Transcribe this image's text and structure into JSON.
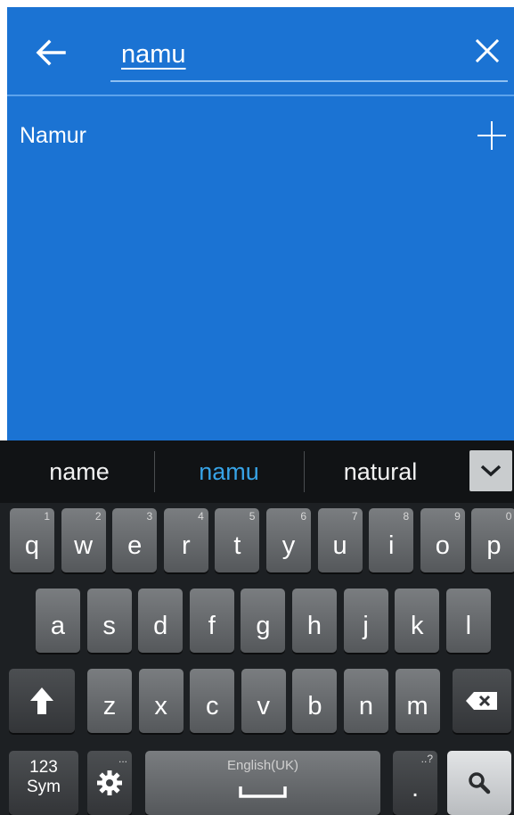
{
  "search": {
    "value": "namu"
  },
  "results": [
    {
      "label": "Namur"
    }
  ],
  "icons": {
    "back": "arrow-left-icon",
    "clear": "close-icon",
    "add": "plus-icon",
    "expand": "chevron-down-icon",
    "shift": "shift-icon",
    "backspace": "backspace-icon",
    "settings": "gear-icon",
    "search": "search-icon",
    "space": "spacebar-icon"
  },
  "colors": {
    "app_background": "#1b73d3",
    "keyboard_background": "#1d2023",
    "suggestion_active": "#37a3e6"
  },
  "keyboard": {
    "suggestions": [
      "name",
      "namu",
      "natural"
    ],
    "active_suggestion_index": 1,
    "row1": [
      {
        "ch": "q",
        "hint": "1"
      },
      {
        "ch": "w",
        "hint": "2"
      },
      {
        "ch": "e",
        "hint": "3"
      },
      {
        "ch": "r",
        "hint": "4"
      },
      {
        "ch": "t",
        "hint": "5"
      },
      {
        "ch": "y",
        "hint": "6"
      },
      {
        "ch": "u",
        "hint": "7"
      },
      {
        "ch": "i",
        "hint": "8"
      },
      {
        "ch": "o",
        "hint": "9"
      },
      {
        "ch": "p",
        "hint": "0"
      }
    ],
    "row2": [
      "a",
      "s",
      "d",
      "f",
      "g",
      "h",
      "j",
      "k",
      "l"
    ],
    "row3": [
      "z",
      "x",
      "c",
      "v",
      "b",
      "n",
      "m"
    ],
    "sym_label_top": "123",
    "sym_label_bottom": "Sym",
    "space_label": "English(UK)",
    "period_label": ".",
    "period_hint": "..?",
    "settings_hint": "..."
  }
}
